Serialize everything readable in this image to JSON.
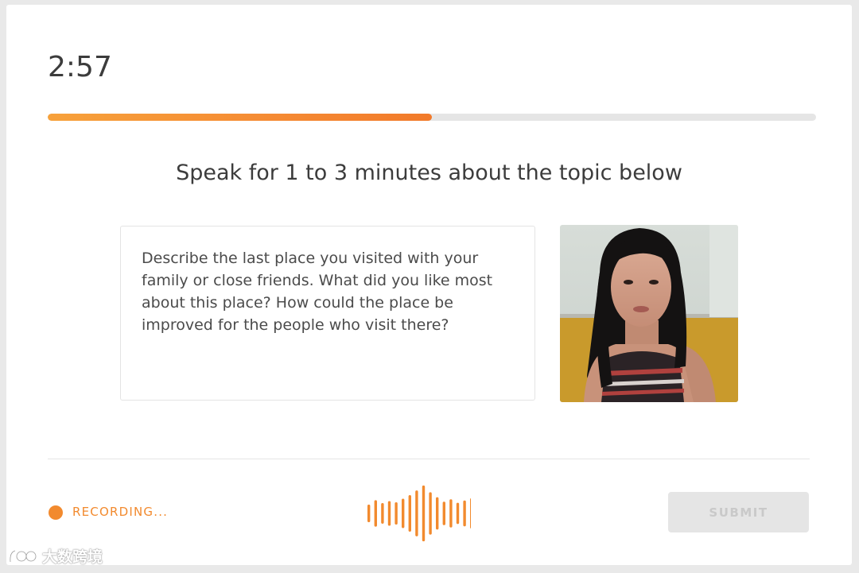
{
  "timer": "2:57",
  "progress": 0.5,
  "instructions": "Speak for 1 to 3 minutes about the topic below",
  "prompt": "Describe the last place you visited with your family or close friends. What did you like most about this place? How could the place be improved for the people who visit there?",
  "recording": {
    "label": "RECORDING..."
  },
  "waveform_levels": [
    0.3,
    0.45,
    0.35,
    0.42,
    0.38,
    0.5,
    0.62,
    0.78,
    0.95,
    0.72,
    0.55,
    0.4,
    0.48,
    0.36,
    0.44,
    0.52
  ],
  "submit_label": "SUBMIT",
  "watermark": {
    "text": "大数跨境"
  },
  "colors": {
    "accent": "#f28a2e",
    "progress_start": "#f7a13a",
    "progress_end": "#f27a2a",
    "disabled_button": "#e5e5e5",
    "disabled_text": "#c9c9c9"
  },
  "icons": {
    "recording_indicator": "recording-dot-icon",
    "audio": "audio-waveform-icon",
    "logo": "watermark-logo-icon"
  }
}
